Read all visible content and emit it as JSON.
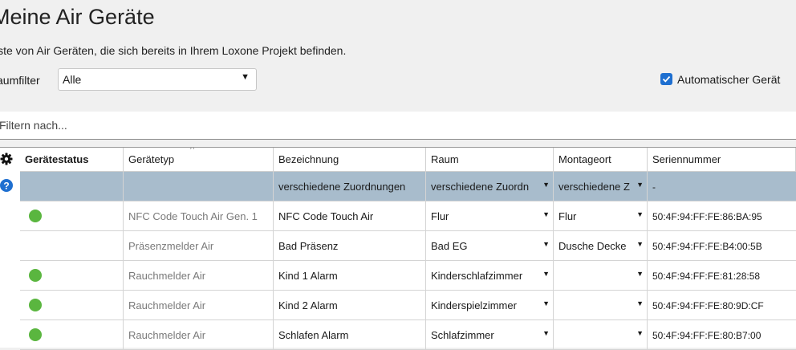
{
  "page": {
    "title": "Meine Air Geräte",
    "subtitle": "iste von Air Geräten, die sich bereits in Ihrem Loxone Projekt befinden."
  },
  "room_filter": {
    "label": "aumfilter",
    "value": "Alle"
  },
  "auto_checkbox": {
    "label": "Automatischer Gerät",
    "checked": true
  },
  "filter": {
    "placeholder": "Filtern nach..."
  },
  "sidebar": {
    "icons": [
      "gear-icon",
      "help-icon"
    ]
  },
  "colors": {
    "accent": "#1e6fd0",
    "status_ok": "#5ab63f",
    "selected_row": "#a8bccc"
  },
  "columns": [
    "Gerätestatus",
    "Gerätetyp",
    "Bezeichnung",
    "Raum",
    "Montageort",
    "Seriennummer"
  ],
  "rows": [
    {
      "status": "",
      "typ": "",
      "bezeichnung": "verschiedene Zuordnungen",
      "raum": "verschiedene Zuordn",
      "montageort": "verschiedene Z",
      "serien": "-",
      "selected": true
    },
    {
      "status": "online",
      "typ": "NFC Code Touch Air Gen. 1",
      "bezeichnung": "NFC Code Touch Air",
      "raum": "Flur",
      "montageort": "Flur",
      "serien": "50:4F:94:FF:FE:86:BA:95"
    },
    {
      "status": "",
      "typ": "Präsenzmelder Air",
      "bezeichnung": "Bad Präsenz",
      "raum": "Bad EG",
      "montageort": "Dusche Decke",
      "serien": "50:4F:94:FF:FE:B4:00:5B"
    },
    {
      "status": "online",
      "typ": "Rauchmelder Air",
      "bezeichnung": "Kind 1 Alarm",
      "raum": "Kinderschlafzimmer",
      "montageort": "",
      "serien": "50:4F:94:FF:FE:81:28:58"
    },
    {
      "status": "online",
      "typ": "Rauchmelder Air",
      "bezeichnung": "Kind 2 Alarm",
      "raum": "Kinderspielzimmer",
      "montageort": "",
      "serien": "50:4F:94:FF:FE:80:9D:CF"
    },
    {
      "status": "online",
      "typ": "Rauchmelder Air",
      "bezeichnung": "Schlafen Alarm",
      "raum": "Schlafzimmer",
      "montageort": "",
      "serien": "50:4F:94:FF:FE:80:B7:00"
    }
  ]
}
